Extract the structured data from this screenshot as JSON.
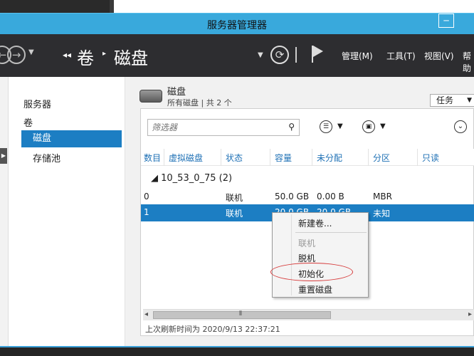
{
  "window": {
    "title": "服务器管理器",
    "system_button": "─"
  },
  "nav": {
    "back_icon": "back-arrow-icon",
    "forward_icon": "forward-arrow-icon",
    "breadcrumb_prefix": "◂◂",
    "breadcrumb": [
      "卷",
      "磁盘"
    ],
    "breadcrumb_sep": "▸",
    "menus": [
      "管理(M)",
      "工具(T)",
      "视图(V)",
      "帮助"
    ]
  },
  "sidebar": {
    "items": [
      {
        "label": "服务器",
        "selected": false
      },
      {
        "label": "卷",
        "selected": false
      },
      {
        "label": "磁盘",
        "selected": true
      },
      {
        "label": "存储池",
        "selected": false
      }
    ]
  },
  "header": {
    "title": "磁盘",
    "subtitle": "所有磁盘 | 共 2 个",
    "tasks_label": "任务"
  },
  "filter": {
    "placeholder": "筛选器"
  },
  "table": {
    "columns": [
      "数目",
      "虚拟磁盘",
      "状态",
      "容量",
      "未分配",
      "分区",
      "只读"
    ],
    "group": "10_53_0_75 (2)",
    "rows": [
      {
        "number": "0",
        "virtual_disk": "",
        "status": "联机",
        "capacity": "50.0 GB",
        "unallocated": "0.00 B",
        "partition": "MBR",
        "readonly": ""
      },
      {
        "number": "1",
        "virtual_disk": "",
        "status": "联机",
        "capacity": "20.0 GB",
        "unallocated": "20.0 GB",
        "partition": "未知",
        "readonly": ""
      }
    ]
  },
  "status": {
    "last_refresh": "上次刷新时间为 2020/9/13 22:37:21"
  },
  "context_menu": {
    "items": [
      {
        "label": "新建卷...",
        "enabled": true
      },
      {
        "label": "联机",
        "enabled": false
      },
      {
        "label": "脱机",
        "enabled": true
      },
      {
        "label": "初始化",
        "enabled": true,
        "highlighted": true
      },
      {
        "label": "重置磁盘",
        "enabled": true
      }
    ]
  },
  "colors": {
    "titlebar": "#39a9dc",
    "navbar": "#2d2d30",
    "selection": "#1c7ec3",
    "header_text": "#1e70b5",
    "annotation": "#d63b3b"
  }
}
